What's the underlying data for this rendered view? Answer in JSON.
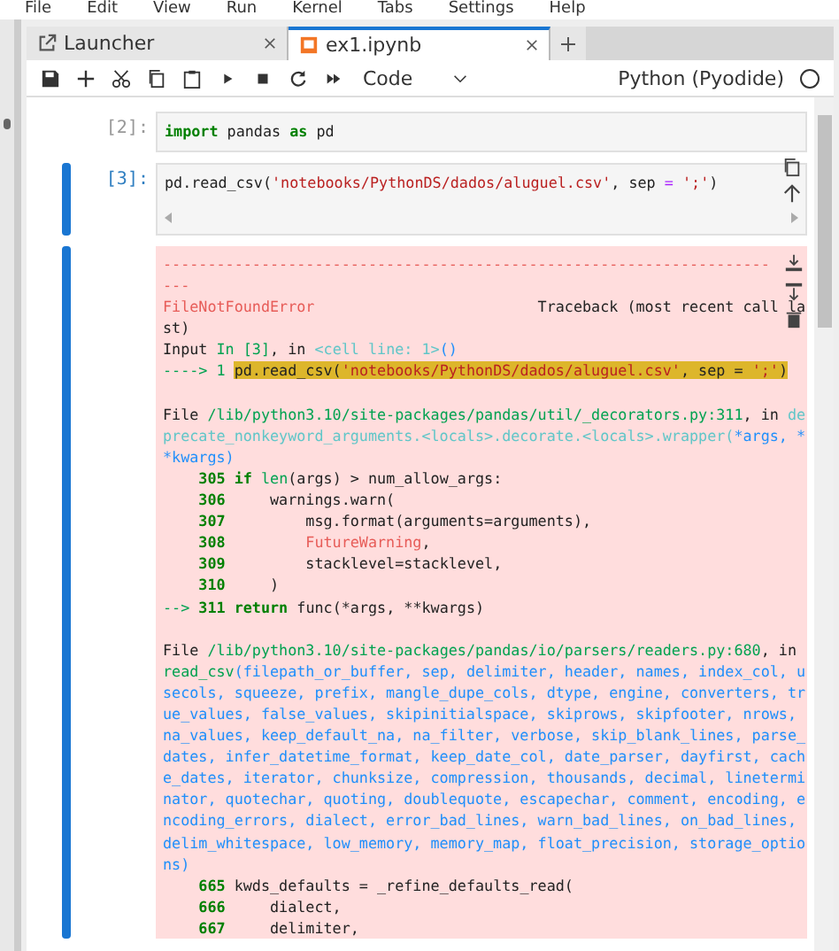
{
  "menu": [
    "File",
    "Edit",
    "View",
    "Run",
    "Kernel",
    "Tabs",
    "Settings",
    "Help"
  ],
  "tabs": [
    {
      "label": "Launcher",
      "selected": false,
      "kind": "launcher"
    },
    {
      "label": "ex1.ipynb",
      "selected": true,
      "kind": "notebook"
    }
  ],
  "toolbar": {
    "cell_type": "Code",
    "kernel": "Python (Pyodide)"
  },
  "cells": [
    {
      "prompt": "[2]:",
      "selected": false,
      "input": [
        [
          {
            "text": "import",
            "kind": "kw"
          },
          {
            "text": " pandas ",
            "kind": "plain"
          },
          {
            "text": "as",
            "kind": "kw"
          },
          {
            "text": " pd",
            "kind": "plain"
          }
        ]
      ]
    },
    {
      "prompt": "[3]:",
      "selected": true,
      "input": [
        [
          {
            "text": "pd.read_csv(",
            "kind": "plain"
          },
          {
            "text": "'notebooks/PythonDS/dados/aluguel.csv'",
            "kind": "str"
          },
          {
            "text": ", sep ",
            "kind": "plain"
          },
          {
            "text": "=",
            "kind": "op"
          },
          {
            "text": " ';'",
            "kind": "str"
          },
          {
            "text": ")",
            "kind": "plain"
          }
        ]
      ],
      "output": [
        {
          "segs": [
            {
              "text": "--------------------------------------------------------------------",
              "kind": "err"
            }
          ]
        },
        {
          "segs": [
            {
              "text": "---",
              "kind": "err"
            }
          ]
        },
        {
          "segs": [
            {
              "text": "FileNotFoundError",
              "kind": "err"
            },
            {
              "text": "                         Traceback (most recent call la",
              "kind": "plain"
            }
          ]
        },
        {
          "segs": [
            {
              "text": "st)",
              "kind": "plain"
            }
          ]
        },
        {
          "segs": [
            {
              "text": "Input ",
              "kind": "plain"
            },
            {
              "text": "In [3]",
              "kind": "green"
            },
            {
              "text": ", in ",
              "kind": "plain"
            },
            {
              "text": "<cell line: 1>",
              "kind": "cyan"
            },
            {
              "text": "()",
              "kind": "blue"
            }
          ]
        },
        {
          "segs": [
            {
              "text": "----> 1 ",
              "kind": "green"
            },
            {
              "text": "pd.read_csv(",
              "kind": "hl"
            },
            {
              "text": "'notebooks/PythonDS/dados/aluguel.csv'",
              "kind": "hlstr"
            },
            {
              "text": ", sep = ",
              "kind": "hl"
            },
            {
              "text": "';'",
              "kind": "hlstr"
            },
            {
              "text": ")",
              "kind": "hl"
            }
          ]
        },
        {
          "gap": true,
          "segs": [
            {
              "text": "File ",
              "kind": "plain"
            },
            {
              "text": "/lib/python3.10/site-packages/pandas/util/_decorators.py:311",
              "kind": "green"
            },
            {
              "text": ", in ",
              "kind": "plain"
            },
            {
              "text": "de",
              "kind": "cyan"
            }
          ]
        },
        {
          "segs": [
            {
              "text": "precate_nonkeyword_arguments.<locals>.decorate.<locals>.wrapper(",
              "kind": "cyan"
            },
            {
              "text": "*args, *",
              "kind": "blue"
            }
          ]
        },
        {
          "segs": [
            {
              "text": "*kwargs)",
              "kind": "blue"
            }
          ]
        },
        {
          "segs": [
            {
              "text": "    305 ",
              "kind": "kw"
            },
            {
              "text": "if",
              "kind": "kw"
            },
            {
              "text": " len",
              "kind": "green"
            },
            {
              "text": "(args) > num_allow_args:",
              "kind": "plain"
            }
          ]
        },
        {
          "segs": [
            {
              "text": "    306 ",
              "kind": "kw"
            },
            {
              "text": "    warnings.warn(",
              "kind": "plain"
            }
          ]
        },
        {
          "segs": [
            {
              "text": "    307 ",
              "kind": "kw"
            },
            {
              "text": "        msg.format(arguments=arguments),",
              "kind": "plain"
            }
          ]
        },
        {
          "segs": [
            {
              "text": "    308 ",
              "kind": "kw"
            },
            {
              "text": "        FutureWarning",
              "kind": "err"
            },
            {
              "text": ",",
              "kind": "plain"
            }
          ]
        },
        {
          "segs": [
            {
              "text": "    309 ",
              "kind": "kw"
            },
            {
              "text": "        stacklevel=stacklevel,",
              "kind": "plain"
            }
          ]
        },
        {
          "segs": [
            {
              "text": "    310 ",
              "kind": "kw"
            },
            {
              "text": "    )",
              "kind": "plain"
            }
          ]
        },
        {
          "segs": [
            {
              "text": "--> ",
              "kind": "green"
            },
            {
              "text": "311 ",
              "kind": "kw"
            },
            {
              "text": "return",
              "kind": "kw"
            },
            {
              "text": " func(*args, **kwargs)",
              "kind": "plain"
            }
          ]
        },
        {
          "gap": true,
          "segs": [
            {
              "text": "File ",
              "kind": "plain"
            },
            {
              "text": "/lib/python3.10/site-packages/pandas/io/parsers/readers.py:680",
              "kind": "green"
            },
            {
              "text": ", in",
              "kind": "plain"
            }
          ]
        },
        {
          "segs": [
            {
              "text": "read_csv",
              "kind": "green"
            },
            {
              "text": "(filepath_or_buffer, sep, delimiter, header, names, index_col, u",
              "kind": "blue"
            }
          ]
        },
        {
          "segs": [
            {
              "text": "secols, squeeze, prefix, mangle_dupe_cols, dtype, engine, converters, tr",
              "kind": "blue"
            }
          ]
        },
        {
          "segs": [
            {
              "text": "ue_values, false_values, skipinitialspace, skiprows, skipfooter, nrows,",
              "kind": "blue"
            }
          ]
        },
        {
          "segs": [
            {
              "text": "na_values, keep_default_na, na_filter, verbose, skip_blank_lines, parse_",
              "kind": "blue"
            }
          ]
        },
        {
          "segs": [
            {
              "text": "dates, infer_datetime_format, keep_date_col, date_parser, dayfirst, cach",
              "kind": "blue"
            }
          ]
        },
        {
          "segs": [
            {
              "text": "e_dates, iterator, chunksize, compression, thousands, decimal, linetermi",
              "kind": "blue"
            }
          ]
        },
        {
          "segs": [
            {
              "text": "nator, quotechar, quoting, doublequote, escapechar, comment, encoding, e",
              "kind": "blue"
            }
          ]
        },
        {
          "segs": [
            {
              "text": "ncoding_errors, dialect, error_bad_lines, warn_bad_lines, on_bad_lines,",
              "kind": "blue"
            }
          ]
        },
        {
          "segs": [
            {
              "text": "delim_whitespace, low_memory, memory_map, float_precision, storage_optio",
              "kind": "blue"
            }
          ]
        },
        {
          "segs": [
            {
              "text": "ns)",
              "kind": "blue"
            }
          ]
        },
        {
          "segs": [
            {
              "text": "    665 ",
              "kind": "kw"
            },
            {
              "text": "kwds_defaults = _refine_defaults_read(",
              "kind": "plain"
            }
          ]
        },
        {
          "segs": [
            {
              "text": "    666 ",
              "kind": "kw"
            },
            {
              "text": "    dialect,",
              "kind": "plain"
            }
          ]
        },
        {
          "segs": [
            {
              "text": "    667 ",
              "kind": "kw"
            },
            {
              "text": "    delimiter,",
              "kind": "plain"
            }
          ]
        }
      ]
    }
  ]
}
